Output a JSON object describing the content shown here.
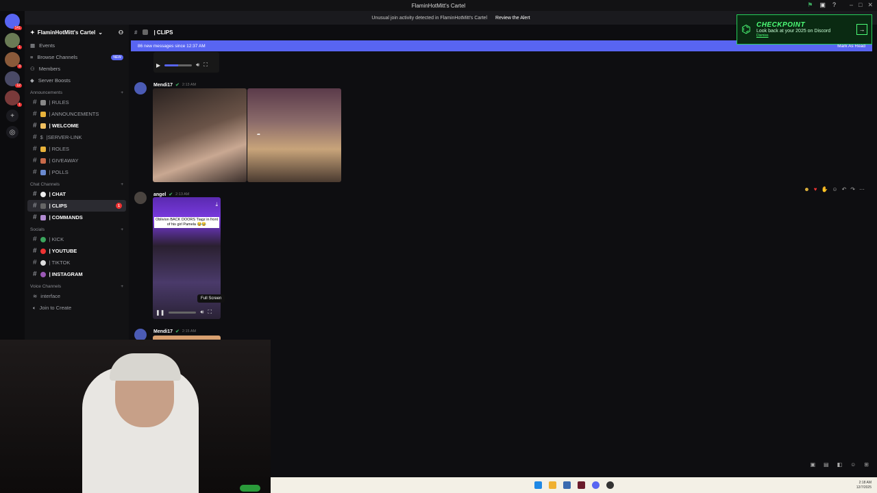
{
  "window": {
    "title": "FlaminHotMitt's Cartel"
  },
  "alert": {
    "text": "Unusual join activity detected in FlaminHotMitt's Cartel",
    "action": "Review the Alert"
  },
  "servers": {
    "badges": [
      "141",
      "1",
      "3",
      "12",
      "1"
    ]
  },
  "guild": {
    "name": "FlaminHotMitt's Cartel"
  },
  "nav": [
    {
      "label": "Events"
    },
    {
      "label": "Browse Channels",
      "badge": "NEW"
    },
    {
      "label": "Members"
    },
    {
      "label": "Server Boosts"
    }
  ],
  "categories": {
    "announcements": "Announcements",
    "chat": "Chat Channels",
    "socials": "Socials",
    "voice": "Voice Channels"
  },
  "channels": {
    "rules": "| RULES",
    "announcements": "| ANNOUNCEMENTS",
    "welcome": "| WELCOME",
    "server_link": "|SERVER-LINK",
    "roles": "| ROLES",
    "giveaway": "| GIVEAWAY",
    "polls": "| POLLS",
    "chat": "| CHAT",
    "clips": "| CLIPS",
    "clips_mentions": "1",
    "commands": "| COMMANDS",
    "kick": "| KICK",
    "youtube": "| YOUTUBE",
    "tiktok": "| TIKTOK",
    "instagram": "| INSTAGRAM",
    "interface": "interface",
    "join_to_create": "Join to Create"
  },
  "header": {
    "channel": "| CLIPS"
  },
  "banner": {
    "text": "86 new messages since 12:37 AM",
    "action": "Mark As Read"
  },
  "messages": [
    {
      "author": "Mendi17",
      "time": "2:13 AM"
    },
    {
      "author": "angel",
      "time": "2:13 AM",
      "caption": "Oblivion BACK DOORS Tiagz in front of his girl Pamela 😂😂",
      "tooltip": "Full Screen"
    },
    {
      "author": "Mendi17",
      "time": "2:15 AM"
    }
  ],
  "checkpoint": {
    "title": "CHECKPOINT",
    "subtitle": "Look back at your 2025 on Discord",
    "link": "Dismiss"
  },
  "taskbar": {
    "time": "2:18 AM",
    "date": "12/7/2025"
  },
  "colors": {
    "accent": "#5865f2",
    "checkpoint_green": "#26d05a",
    "mention_red": "#e33333"
  }
}
